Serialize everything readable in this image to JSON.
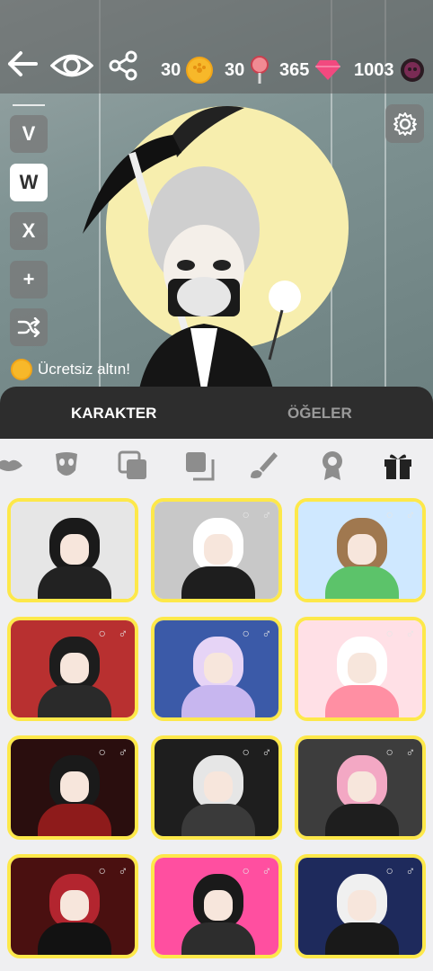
{
  "header": {
    "back_icon": "back-arrow-icon",
    "eye_icon": "eye-icon",
    "share_icon": "share-icon",
    "resources": [
      {
        "value": "30",
        "icon": "gold-coin-icon",
        "color": "#f7b82a"
      },
      {
        "value": "30",
        "icon": "lollipop-icon",
        "color": "#e86a75"
      },
      {
        "value": "365",
        "icon": "gem-icon",
        "color": "#f2497f"
      },
      {
        "value": "1003",
        "icon": "skull-coin-icon",
        "color": "#7a2b54"
      }
    ]
  },
  "side_buttons": [
    "V",
    "W",
    "X",
    "+"
  ],
  "shuffle_icon": "shuffle-icon",
  "settings_icon": "gear-icon",
  "free_gold": {
    "label": "Ücretsiz altın!",
    "icon": "gold-coin-icon"
  },
  "tabs": [
    {
      "label": "KARAKTER",
      "active": true
    },
    {
      "label": "ÖĞELER",
      "active": false
    }
  ],
  "categories": [
    "lips-icon",
    "mask-icon",
    "layers-icon",
    "layers-alt-icon",
    "paintbrush-icon",
    "award-icon",
    "gift-icon"
  ],
  "cards": [
    {
      "name": "card-1",
      "bg": "#e6e6e6",
      "hair": "#1a1a1a",
      "body": "#222222",
      "accent": "#c07ad9"
    },
    {
      "name": "card-2",
      "bg": "#c8c8c8",
      "hair": "#ffffff",
      "body": "#1e1e1e",
      "accent": "#ff4d4d"
    },
    {
      "name": "card-3",
      "bg": "#cfe8ff",
      "hair": "#a0784f",
      "body": "#5cc36a",
      "accent": "#ff6e6e"
    },
    {
      "name": "card-4",
      "bg": "#b83030",
      "hair": "#1d1d1d",
      "body": "#2a2a2a",
      "accent": "#ffffff"
    },
    {
      "name": "card-5",
      "bg": "#3b5aa8",
      "hair": "#e6d4f6",
      "body": "#c7b6ef",
      "accent": "#ffd36e"
    },
    {
      "name": "card-6",
      "bg": "#ffe0e6",
      "hair": "#ffffff",
      "body": "#ff8fa3",
      "accent": "#ff4d6d"
    },
    {
      "name": "card-7",
      "bg": "#2a0e0e",
      "hair": "#1a1a1a",
      "body": "#8e1b1b",
      "accent": "#ffffff"
    },
    {
      "name": "card-8",
      "bg": "#1e1e1e",
      "hair": "#e6e6e6",
      "body": "#3a3a3a",
      "accent": "#ffffff"
    },
    {
      "name": "card-9",
      "bg": "#3d3d3d",
      "hair": "#f3a8c4",
      "body": "#1e1e1e",
      "accent": "#ffffff"
    },
    {
      "name": "card-10",
      "bg": "#4a1010",
      "hair": "#b3252f",
      "body": "#121212",
      "accent": "#e34b4b"
    },
    {
      "name": "card-11",
      "bg": "#ff4fa0",
      "hair": "#1a1a1a",
      "body": "#2d2d2d",
      "accent": "#ffffff"
    },
    {
      "name": "card-12",
      "bg": "#1e2a5c",
      "hair": "#f0f0f0",
      "body": "#191919",
      "accent": "#2f7bff"
    }
  ]
}
